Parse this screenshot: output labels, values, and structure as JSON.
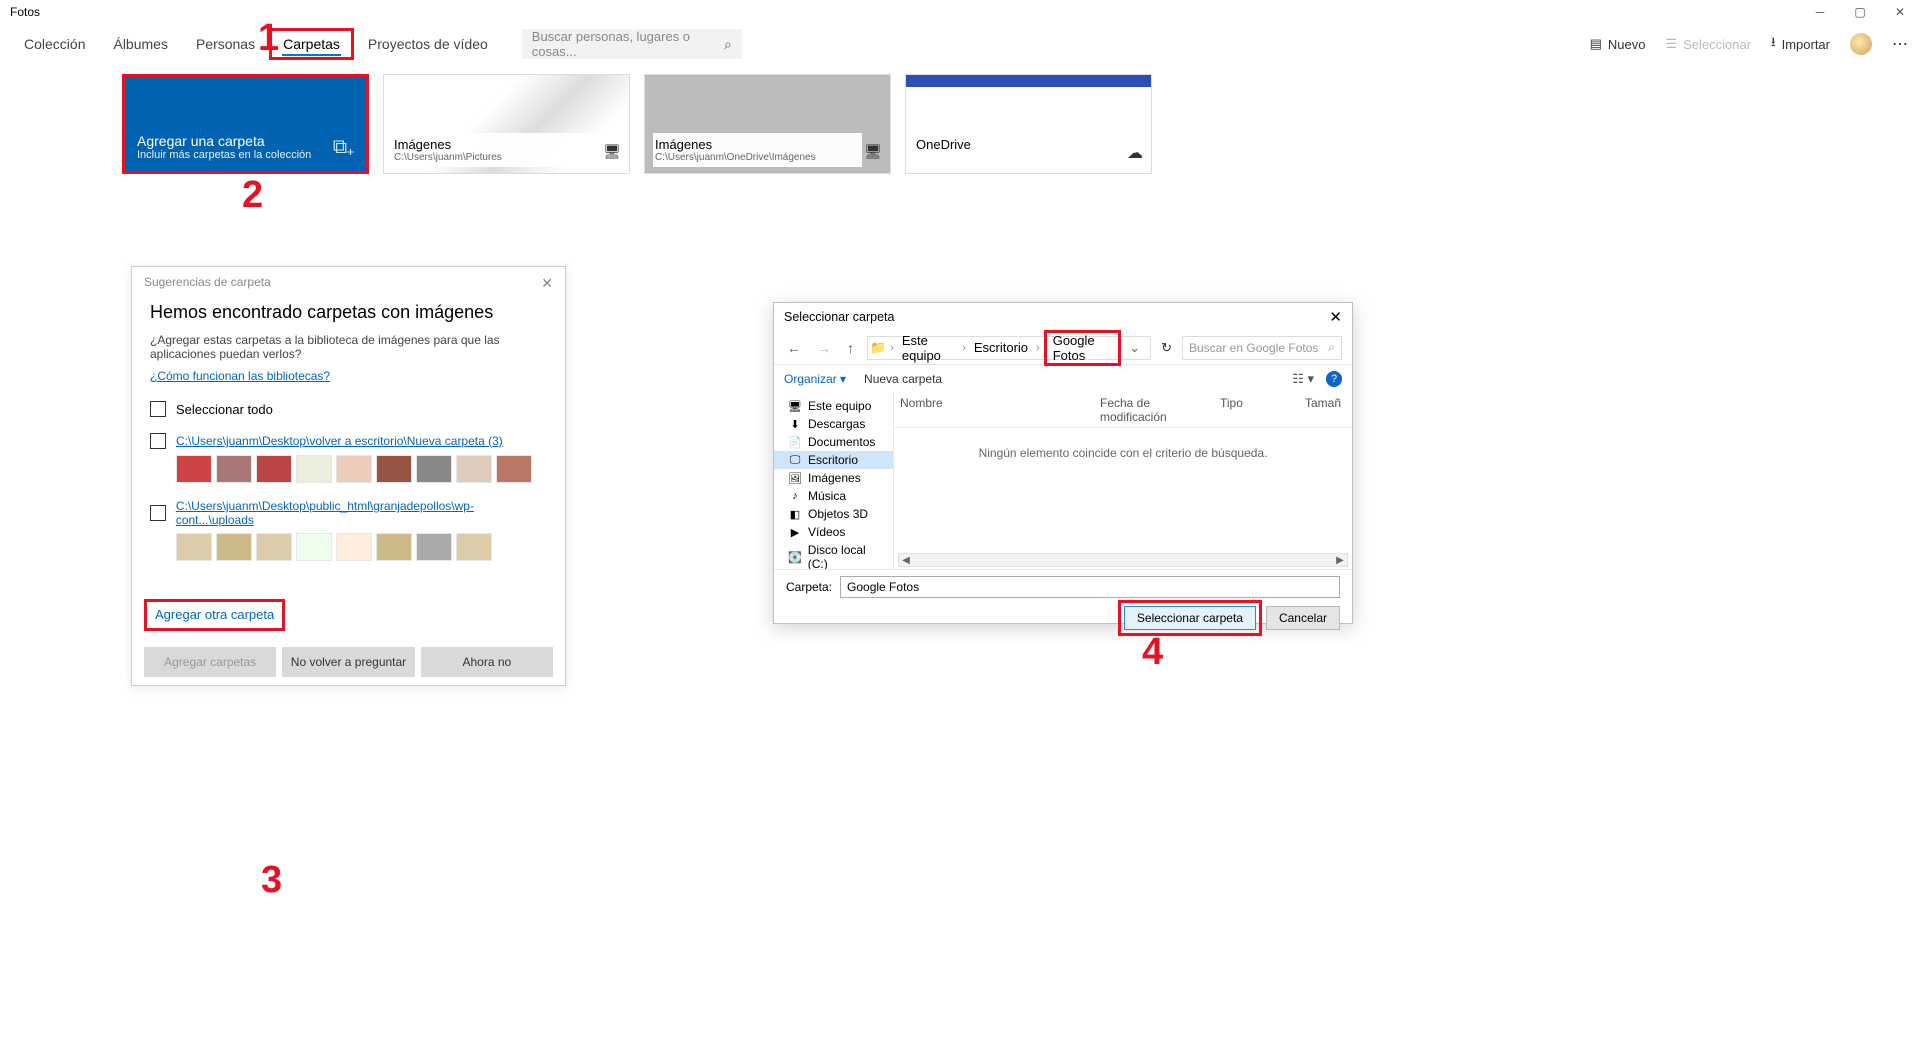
{
  "app": {
    "title": "Fotos"
  },
  "tabs": {
    "collection": "Colección",
    "albums": "Álbumes",
    "people": "Personas",
    "folders": "Carpetas",
    "video": "Proyectos de vídeo"
  },
  "search": {
    "placeholder": "Buscar personas, lugares o cosas..."
  },
  "topright": {
    "new": "Nuevo",
    "select": "Seleccionar",
    "import": "Importar"
  },
  "cards": {
    "add": {
      "title": "Agregar una carpeta",
      "subtitle": "Incluir más carpetas en la colección"
    },
    "c1": {
      "title": "Imágenes",
      "path": "C:\\Users\\juanm\\Pictures"
    },
    "c2": {
      "title": "Imágenes",
      "path": "C:\\Users\\juanm\\OneDrive\\Imágenes"
    },
    "c3": {
      "title": "OneDrive"
    }
  },
  "steps": {
    "s1": "1",
    "s2": "2",
    "s3": "3",
    "s4": "4"
  },
  "sugdlg": {
    "hdr": "Sugerencias de carpeta",
    "h2": "Hemos encontrado carpetas con imágenes",
    "desc": "¿Agregar estas carpetas a la biblioteca de imágenes para que las aplicaciones puedan verlos?",
    "howlink": "¿Cómo funcionan las bibliotecas?",
    "selectall": "Seleccionar todo",
    "path1": "C:\\Users\\juanm\\Desktop\\volver a escritorio\\Nueva carpeta (3)",
    "path2": "C:\\Users\\juanm\\Desktop\\public_html\\granjadepollos\\wp-cont...\\uploads",
    "addother": "Agregar otra carpeta",
    "btn_add": "Agregar carpetas",
    "btn_noask": "No volver a preguntar",
    "btn_notnow": "Ahora no"
  },
  "picker": {
    "title": "Seleccionar carpeta",
    "crumbs": {
      "thispc": "Este equipo",
      "desktop": "Escritorio",
      "gf": "Google Fotos"
    },
    "refresh": "↻",
    "search_placeholder": "Buscar en Google Fotos",
    "toolbar": {
      "org": "Organizar",
      "new": "Nueva carpeta"
    },
    "side": {
      "thispc": "Este equipo",
      "downloads": "Descargas",
      "documents": "Documentos",
      "desktop": "Escritorio",
      "images": "Imágenes",
      "music": "Música",
      "objects3d": "Objetos 3D",
      "videos": "Vídeos",
      "diskc": "Disco local (C:)"
    },
    "cols": {
      "name": "Nombre",
      "date": "Fecha de modificación",
      "type": "Tipo",
      "size": "Tamañ"
    },
    "empty": "Ningún elemento coincide con el criterio de búsqueda.",
    "folder_label": "Carpeta:",
    "folder_value": "Google Fotos",
    "btn_select": "Seleccionar carpeta",
    "btn_cancel": "Cancelar"
  }
}
